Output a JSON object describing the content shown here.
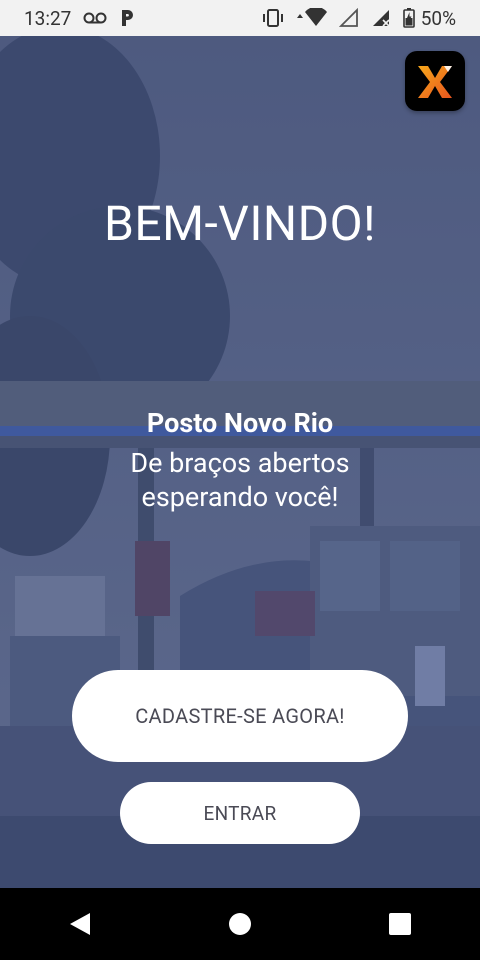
{
  "status_bar": {
    "time": "13:27",
    "battery_percent": "50%",
    "icons": [
      "voicemail-icon",
      "parking-app-icon",
      "vibrate-icon",
      "wifi-icon",
      "no-signal-icon",
      "mobile-signal-icon",
      "battery-icon"
    ]
  },
  "app": {
    "badge_letter": "X",
    "badge_colors": [
      "#f7a81b",
      "#e8541e"
    ]
  },
  "main": {
    "welcome_title": "BEM-VINDO!",
    "place_name": "Posto Novo Rio",
    "tagline_line1": "De braços abertos",
    "tagline_line2": "esperando você!"
  },
  "actions": {
    "register_label": "CADASTRE-SE AGORA!",
    "enter_label": "ENTRAR"
  },
  "navigation": {
    "icons": [
      "back-icon",
      "home-icon",
      "recents-icon"
    ]
  },
  "theme": {
    "overlay_color": "#3f4f82",
    "button_text_color": "#4a4a55"
  }
}
